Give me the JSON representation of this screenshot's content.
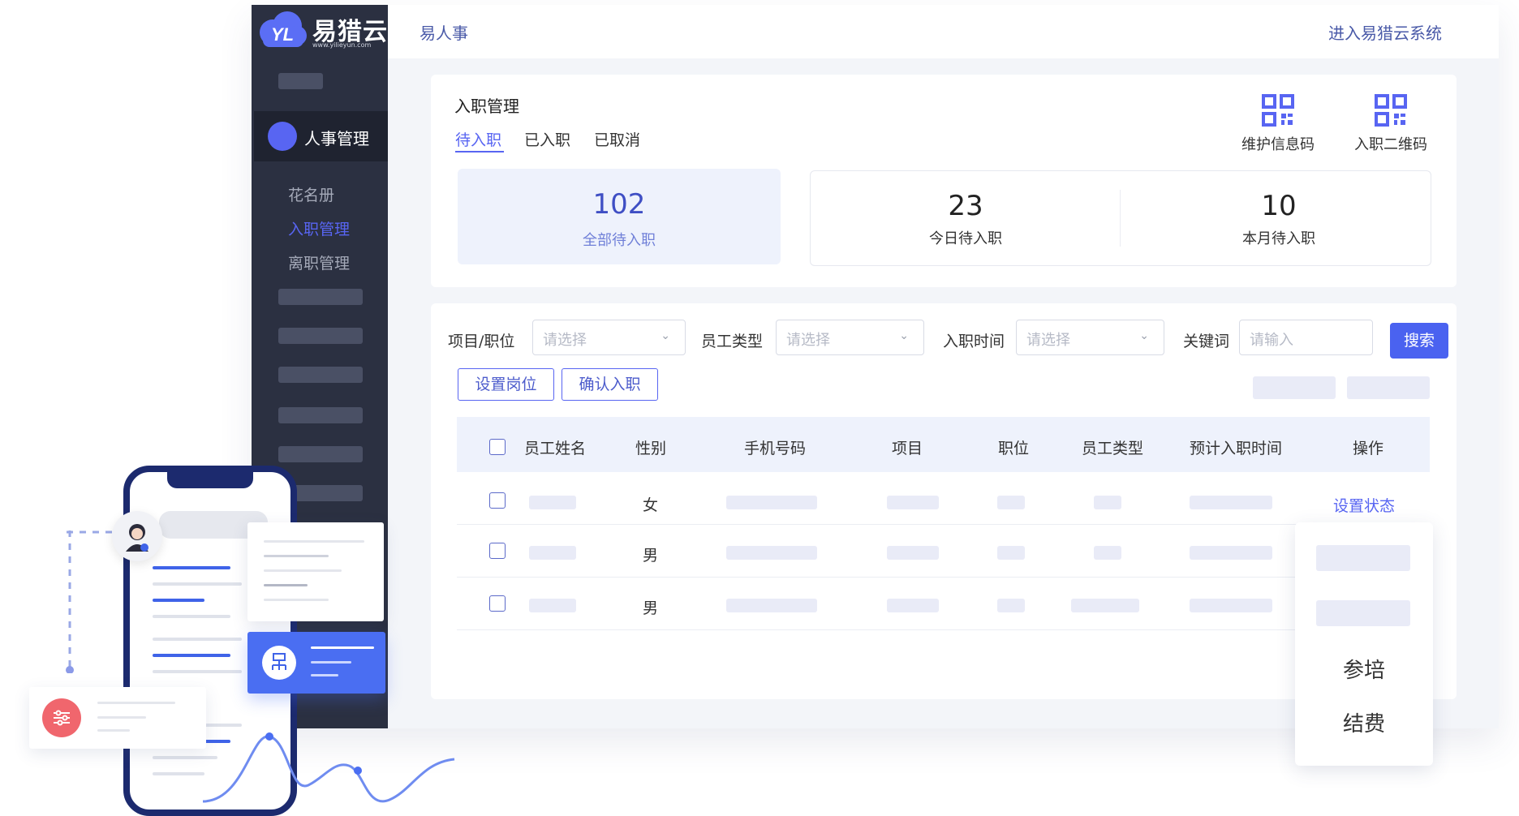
{
  "brand": {
    "name": "易猎云",
    "url": "www.yilieyun.com",
    "logo_mark": "YL"
  },
  "colors": {
    "accent": "#5865f2",
    "sidebar": "#2b3041",
    "phone": "#1c2a6e"
  },
  "sidebar": {
    "active_menu": "人事管理",
    "submenu": [
      "花名册",
      "入职管理",
      "离职管理"
    ],
    "active_submenu_index": 1
  },
  "topbar": {
    "title": "易人事",
    "link": "进入易猎云系统"
  },
  "page": {
    "title": "入职管理",
    "tabs": [
      "待入职",
      "已入职",
      "已取消"
    ],
    "active_tab_index": 0,
    "actions": [
      {
        "label": "维护信息码",
        "icon": "qr-code-icon"
      },
      {
        "label": "入职二维码",
        "icon": "qr-code-icon"
      }
    ]
  },
  "stats": [
    {
      "value": "102",
      "label": "全部待入职"
    },
    {
      "value": "23",
      "label": "今日待入职"
    },
    {
      "value": "10",
      "label": "本月待入职"
    }
  ],
  "filters": [
    {
      "label": "项目/职位",
      "placeholder": "请选择"
    },
    {
      "label": "员工类型",
      "placeholder": "请选择"
    },
    {
      "label": "入职时间",
      "placeholder": "请选择"
    },
    {
      "label": "关键词",
      "placeholder": "请输入"
    }
  ],
  "buttons": {
    "search": "搜索",
    "set_post": "设置岗位",
    "confirm": "确认入职"
  },
  "table": {
    "columns": [
      "员工姓名",
      "性别",
      "手机号码",
      "项目",
      "职位",
      "员工类型",
      "预计入职时间",
      "操作"
    ],
    "rows": [
      {
        "gender": "女",
        "action": "设置状态"
      },
      {
        "gender": "男",
        "action": ""
      },
      {
        "gender": "男",
        "action": ""
      }
    ]
  },
  "dropdown": {
    "items": [
      "参培",
      "结费"
    ]
  }
}
